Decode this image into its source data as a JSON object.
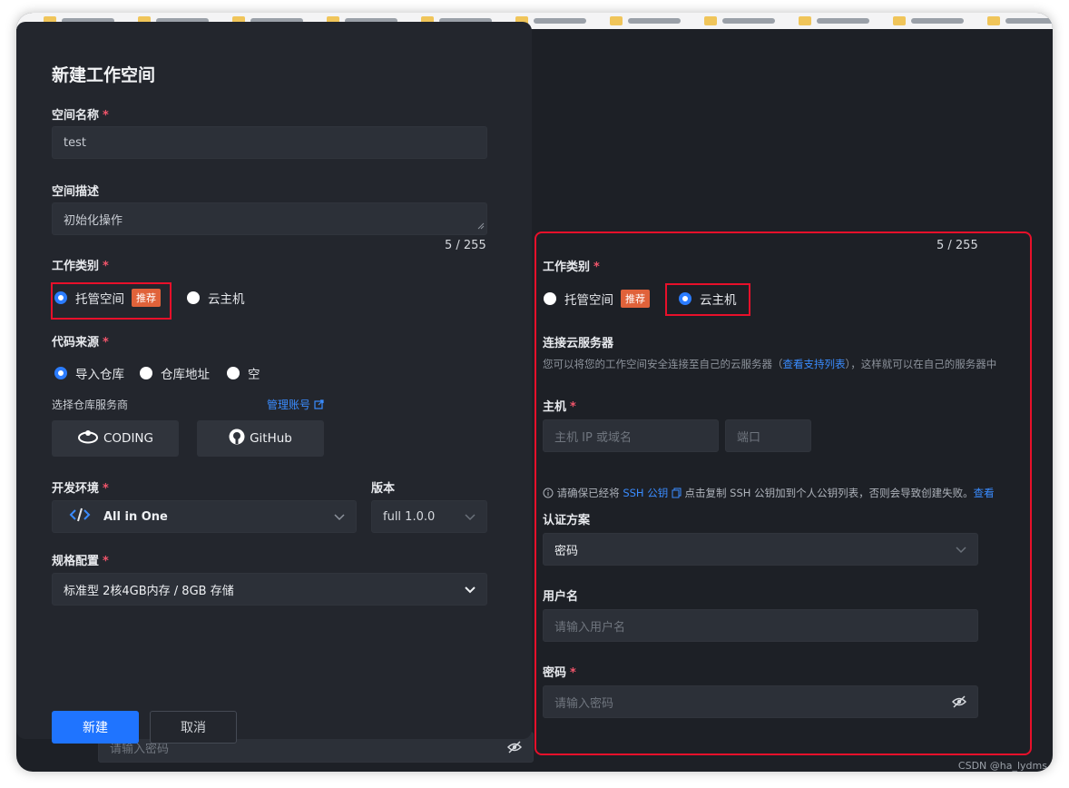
{
  "dialog": {
    "title": "新建工作空间",
    "space_name": {
      "label": "空间名称",
      "required": "*",
      "value": "test"
    },
    "space_desc": {
      "label": "空间描述",
      "value": "初始化操作",
      "counter": "5 / 255"
    },
    "work_type": {
      "label": "工作类别",
      "required": "*",
      "options": [
        "托管空间",
        "云主机"
      ],
      "tag": "推荐",
      "selected": "托管空间"
    },
    "code_source": {
      "label": "代码来源",
      "required": "*",
      "options": [
        "导入仓库",
        "仓库地址",
        "空"
      ],
      "selected": "导入仓库"
    },
    "repo_provider": {
      "label": "选择仓库服务商",
      "manage_link": "管理账号",
      "providers": [
        "CODING",
        "GitHub"
      ]
    },
    "dev_env": {
      "label": "开发环境",
      "required": "*",
      "value": "All in One"
    },
    "version": {
      "label": "版本",
      "value": "full 1.0.0"
    },
    "spec": {
      "label": "规格配置",
      "required": "*",
      "value": "标准型 2核4GB内存 / 8GB 存储"
    },
    "buttons": {
      "create": "新建",
      "cancel": "取消"
    },
    "bleed_password_placeholder": "请输入密码"
  },
  "right_panel": {
    "counter": "5 / 255",
    "work_type": {
      "label": "工作类别",
      "required": "*",
      "options": [
        "托管空间",
        "云主机"
      ],
      "tag": "推荐",
      "selected": "云主机"
    },
    "connect": {
      "title": "连接云服务器",
      "hint_prefix": "您可以将您的工作空间安全连接至自己的云服务器（",
      "hint_link": "查看支持列表",
      "hint_suffix": "），这样就可以在自己的服务器中"
    },
    "host": {
      "label": "主机",
      "required": "*",
      "host_placeholder": "主机 IP 或域名",
      "port_placeholder": "端口"
    },
    "ssh_note": {
      "prefix": "请确保已经将 ",
      "key": "SSH 公钥",
      "middle": " 点击复制 SSH 公钥加到个人公钥列表，否则会导致创建失败。",
      "link": "查看"
    },
    "auth": {
      "label": "认证方案",
      "value": "密码"
    },
    "username": {
      "label": "用户名",
      "placeholder": "请输入用户名"
    },
    "password": {
      "label": "密码",
      "required": "*",
      "placeholder": "请输入密码"
    }
  },
  "watermark": "CSDN @ha_lydms"
}
